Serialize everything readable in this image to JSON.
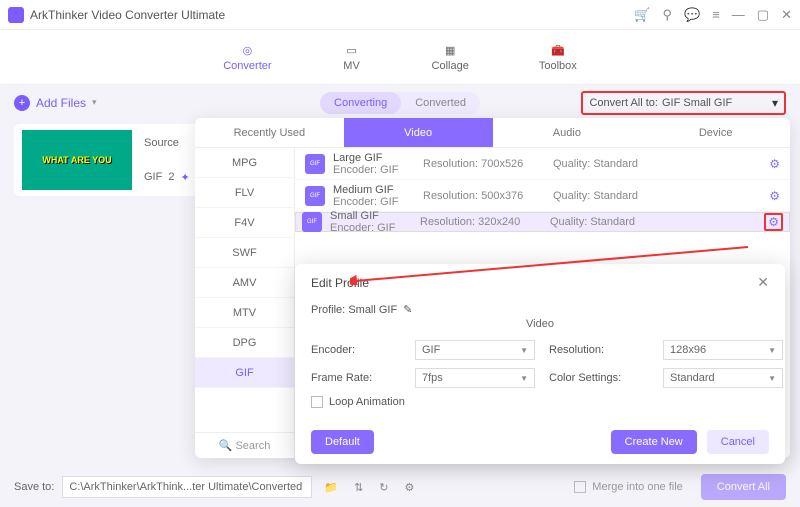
{
  "app": {
    "title": "ArkThinker Video Converter Ultimate"
  },
  "nav": {
    "converter": "Converter",
    "mv": "MV",
    "collage": "Collage",
    "toolbox": "Toolbox"
  },
  "toolbar": {
    "add_files": "Add Files",
    "converting": "Converting",
    "converted": "Converted",
    "convert_all_label": "Convert All to:",
    "convert_all_value": "GIF Small GIF"
  },
  "media": {
    "source_label": "Source",
    "thumb_text": "WHAT ARE YOU",
    "badge": "GIF",
    "count": "2"
  },
  "fmt": {
    "tabs": {
      "recent": "Recently Used",
      "video": "Video",
      "audio": "Audio",
      "device": "Device"
    },
    "cats": [
      "MPG",
      "FLV",
      "F4V",
      "SWF",
      "AMV",
      "MTV",
      "DPG",
      "GIF"
    ],
    "search": "Search",
    "rows": [
      {
        "name": "Large GIF",
        "enc": "Encoder: GIF",
        "res": "Resolution: 700x526",
        "q": "Quality: Standard"
      },
      {
        "name": "Medium GIF",
        "enc": "Encoder: GIF",
        "res": "Resolution: 500x376",
        "q": "Quality: Standard"
      },
      {
        "name": "Small GIF",
        "enc": "Encoder: GIF",
        "res": "Resolution: 320x240",
        "q": "Quality: Standard"
      }
    ]
  },
  "edit": {
    "title": "Edit Profile",
    "profile_label": "Profile:",
    "profile_value": "Small GIF",
    "section": "Video",
    "encoder_label": "Encoder:",
    "encoder_value": "GIF",
    "resolution_label": "Resolution:",
    "resolution_value": "128x96",
    "framerate_label": "Frame Rate:",
    "framerate_value": "7fps",
    "color_label": "Color Settings:",
    "color_value": "Standard",
    "loop": "Loop Animation",
    "default": "Default",
    "create": "Create New",
    "cancel": "Cancel"
  },
  "bottom": {
    "save_to": "Save to:",
    "path": "C:\\ArkThinker\\ArkThink...ter Ultimate\\Converted",
    "merge": "Merge into one file",
    "convert_all": "Convert All"
  }
}
